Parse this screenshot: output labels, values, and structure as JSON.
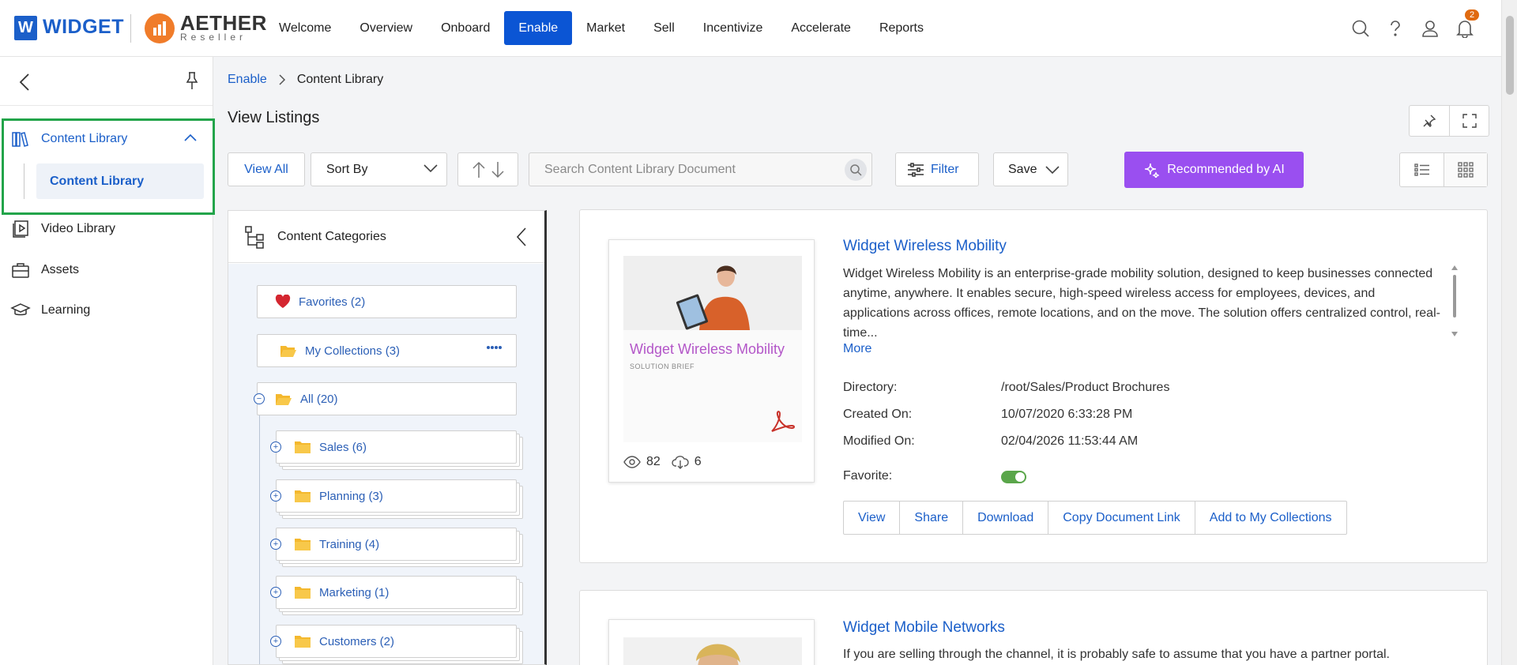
{
  "brand": {
    "logo_letter": "W",
    "name": "WIDGET",
    "partner_name": "AETHER",
    "partner_sub": "Reseller"
  },
  "nav": {
    "items": [
      "Welcome",
      "Overview",
      "Onboard",
      "Enable",
      "Market",
      "Sell",
      "Incentivize",
      "Accelerate",
      "Reports"
    ],
    "active": "Enable"
  },
  "notifications": {
    "count": "2"
  },
  "sidebar": {
    "items": [
      {
        "label": "Content Library",
        "icon": "books-icon",
        "expanded": true
      },
      {
        "label": "Video Library",
        "icon": "video-library-icon"
      },
      {
        "label": "Assets",
        "icon": "briefcase-icon"
      },
      {
        "label": "Learning",
        "icon": "graduation-cap-icon"
      }
    ],
    "sub_items": [
      "Content Library"
    ]
  },
  "breadcrumb": {
    "parent": "Enable",
    "current": "Content Library"
  },
  "page": {
    "title": "View Listings"
  },
  "toolbar": {
    "view_all": "View All",
    "sort_by": "Sort By",
    "search_placeholder": "Search Content Library Document",
    "filter": "Filter",
    "save": "Save",
    "recommended": "Recommended by AI"
  },
  "categories": {
    "title": "Content Categories",
    "favorites": "Favorites (2)",
    "collections": "My Collections (3)",
    "all": "All (20)",
    "folders": [
      "Sales (6)",
      "Planning (3)",
      "Training (4)",
      "Marketing (1)",
      "Customers (2)"
    ]
  },
  "documents": [
    {
      "title": "Widget Wireless Mobility",
      "thumb_title": "Widget Wireless Mobility",
      "thumb_subtitle": "SOLUTION BRIEF",
      "description": "Widget Wireless Mobility is an enterprise-grade mobility solution, designed to keep businesses connected anytime, anywhere. It enables secure, high-speed wireless access for employees, devices, and applications across offices, remote locations, and on the move. The solution offers centralized control, real-time...",
      "more": "More",
      "views": "82",
      "downloads": "6",
      "meta": [
        {
          "label": "Directory:",
          "value": "/root/Sales/Product Brochures"
        },
        {
          "label": "Created On:",
          "value": "10/07/2020 6:33:28 PM"
        },
        {
          "label": "Modified On:",
          "value": "02/04/2026 11:53:44 AM"
        }
      ],
      "favorite_label": "Favorite:",
      "favorite": true,
      "actions": [
        "View",
        "Share",
        "Download",
        "Copy Document Link",
        "Add to My Collections"
      ]
    },
    {
      "title": "Widget Mobile Networks",
      "description": "If you are selling through the channel, it is probably safe to assume that you have a partner portal."
    }
  ],
  "colors": {
    "accent": "#0b55d4",
    "ai": "#9a4ff0",
    "highlight_border": "#22a44a",
    "toggle_on": "#5aa64a"
  }
}
